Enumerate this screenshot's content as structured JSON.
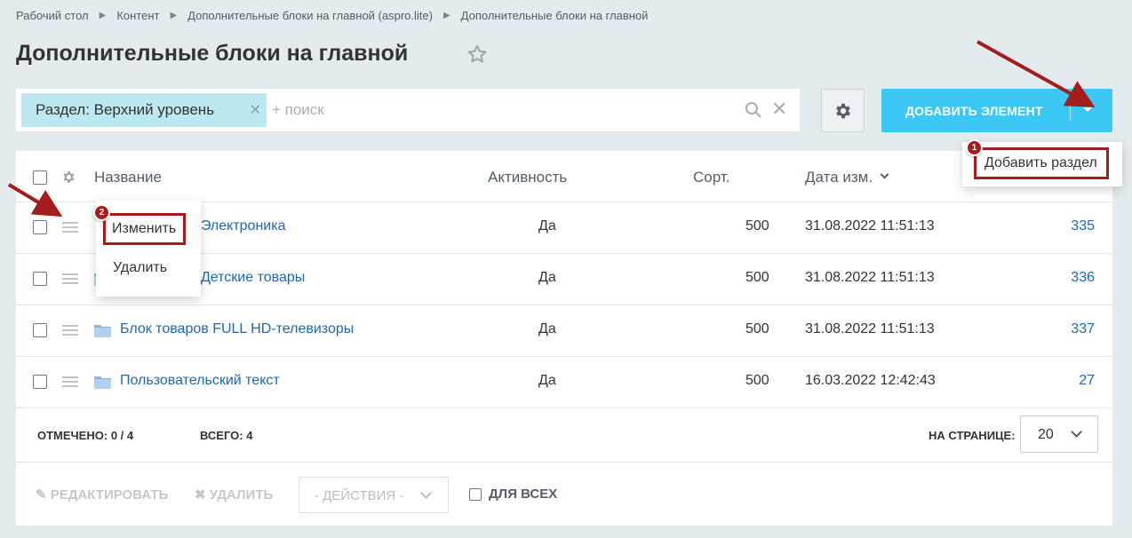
{
  "breadcrumb": [
    "Рабочий стол",
    "Контент",
    "Дополнительные блоки на главной (aspro.lite)",
    "Дополнительные блоки на главной"
  ],
  "page_title": "Дополнительные блоки на главной",
  "filter": {
    "tag": "Раздел: Верхний уровень",
    "search_placeholder": "+ поиск"
  },
  "add_button": {
    "label": "ДОБАВИТЬ ЭЛЕМЕНТ"
  },
  "add_menu": {
    "item": "Добавить раздел",
    "badge": "1"
  },
  "row_menu": {
    "edit": "Изменить",
    "delete": "Удалить",
    "badge": "2"
  },
  "table": {
    "headers": {
      "name": "Название",
      "active": "Активность",
      "sort": "Сорт.",
      "date": "Дата изм."
    },
    "rows": [
      {
        "name": "Блок товаров Электроника",
        "active": "Да",
        "sort": "500",
        "date": "31.08.2022 11:51:13",
        "id": "335"
      },
      {
        "name": "Блок товаров Детские товары",
        "active": "Да",
        "sort": "500",
        "date": "31.08.2022 11:51:13",
        "id": "336"
      },
      {
        "name": "Блок товаров FULL HD-телевизоры",
        "active": "Да",
        "sort": "500",
        "date": "31.08.2022 11:51:13",
        "id": "337"
      },
      {
        "name": "Пользовательский текст",
        "active": "Да",
        "sort": "500",
        "date": "16.03.2022 12:42:43",
        "id": "27"
      }
    ],
    "visible_names": [
      "в Электроника",
      "в Детские товары"
    ]
  },
  "footer": {
    "selected_label": "ОТМЕЧЕНО:",
    "selected_value": "0 / 4",
    "total_label": "ВСЕГО:",
    "total_value": "4",
    "per_page_label": "НА СТРАНИЦЕ:",
    "per_page_value": "20"
  },
  "bottom_bar": {
    "edit": "РЕДАКТИРОВАТЬ",
    "delete": "УДАЛИТЬ",
    "actions": "- ДЕЙСТВИЯ -",
    "for_all": "ДЛЯ ВСЕХ"
  },
  "colors": {
    "accent": "#3bc8f5",
    "highlight": "#a51c1c",
    "link": "#2067b0",
    "tag_bg": "#bce8f1"
  }
}
